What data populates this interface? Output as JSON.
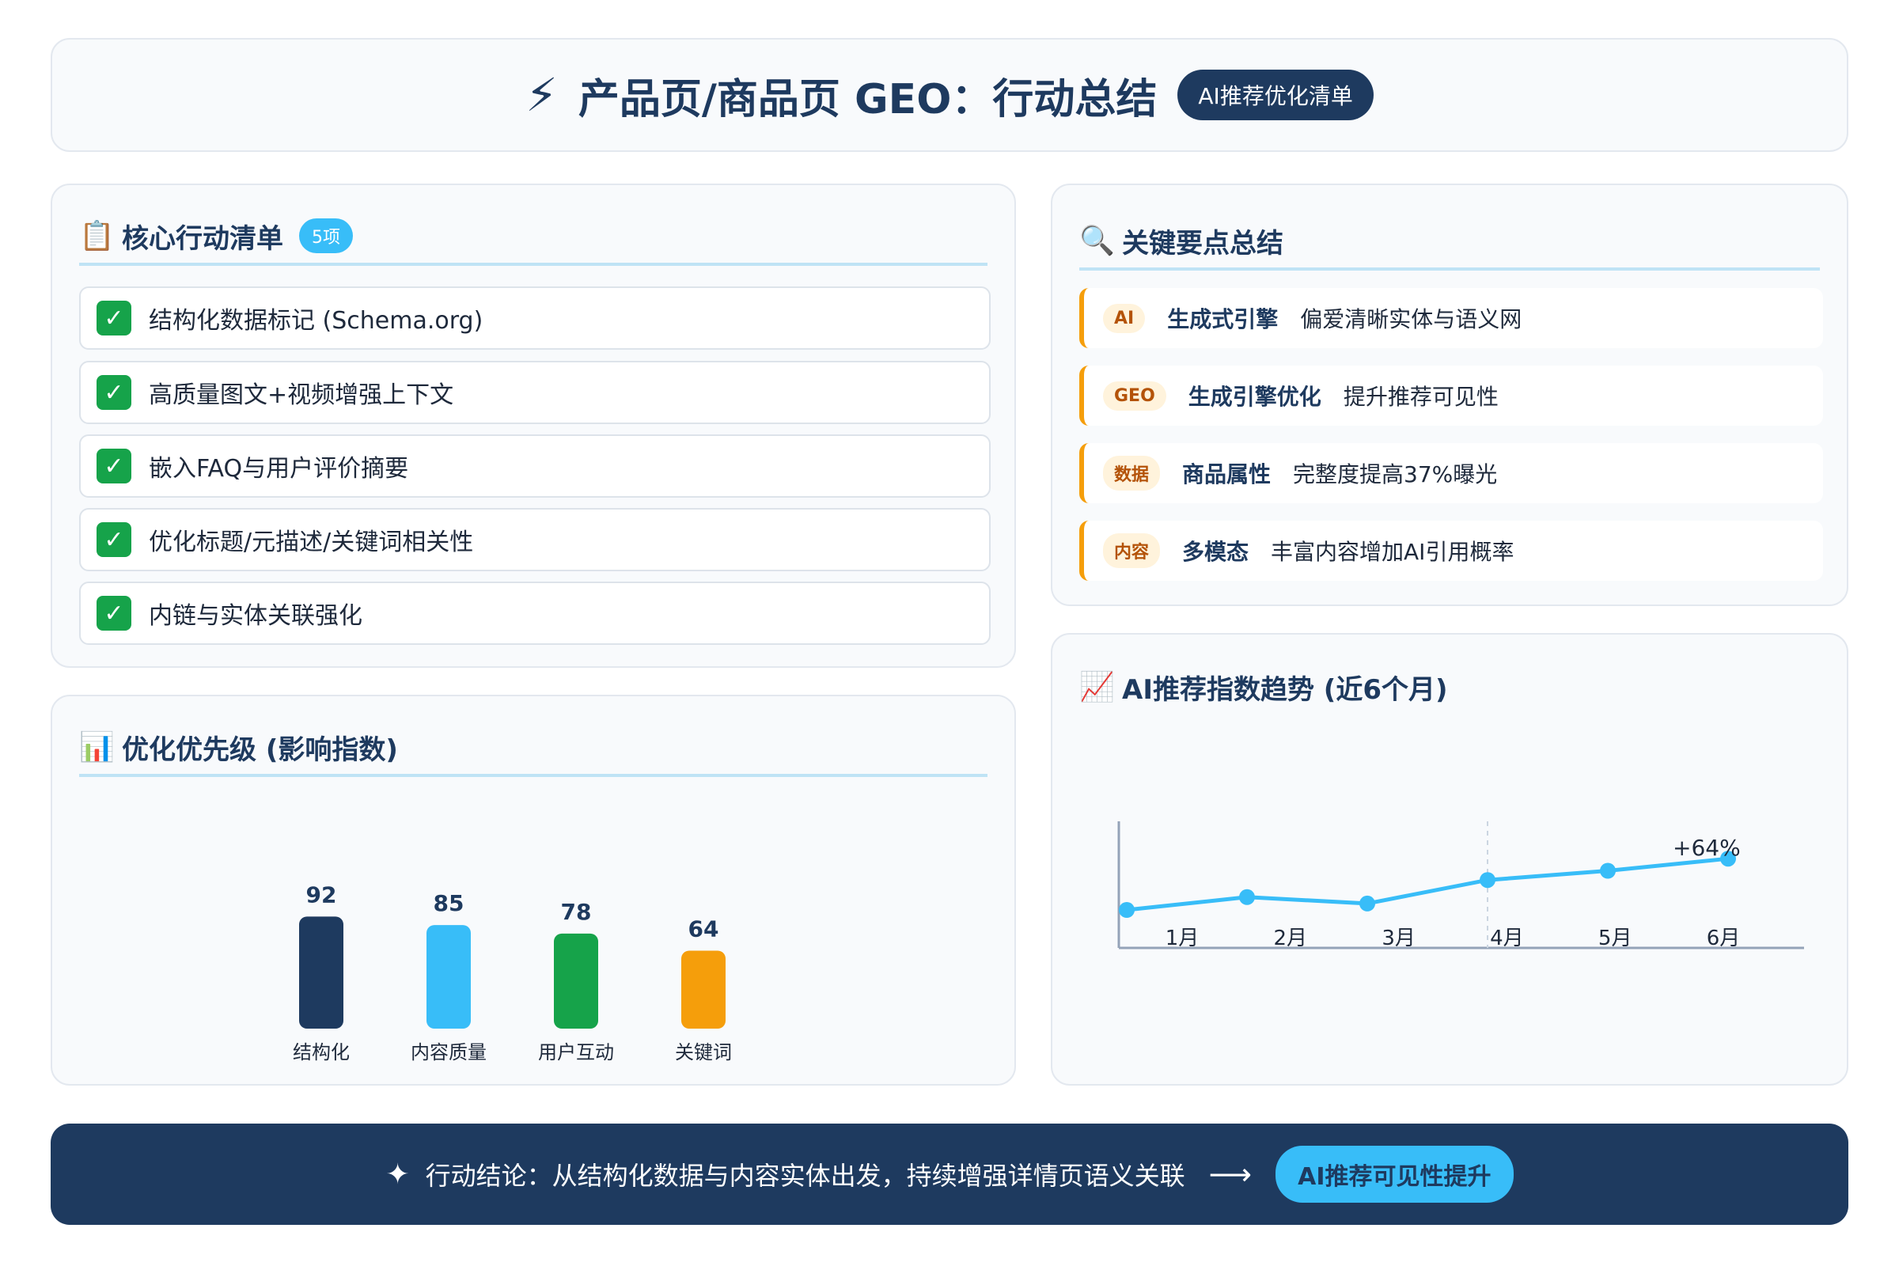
{
  "header": {
    "icon": "lightning-icon",
    "title": "产品页/商品页 GEO：行动总结",
    "tag": "AI推荐优化清单"
  },
  "actions": {
    "icon": "clipboard-icon",
    "title": "核心行动清单",
    "count_badge": "5项",
    "items": [
      {
        "label": "结构化数据标记 (Schema.org)"
      },
      {
        "label": "高质量图文+视频增强上下文"
      },
      {
        "label": "嵌入FAQ与用户评价摘要"
      },
      {
        "label": "优化标题/元描述/关键词相关性"
      },
      {
        "label": "内链与实体关联强化"
      }
    ]
  },
  "keypoints": {
    "icon": "magnifier-icon",
    "title": "关键要点总结",
    "items": [
      {
        "badge": "AI",
        "key": "生成式引擎",
        "desc": "偏爱清晰实体与语义网"
      },
      {
        "badge": "GEO",
        "key": "生成引擎优化",
        "desc": "提升推荐可见性"
      },
      {
        "badge": "数据",
        "key": "商品属性",
        "desc": "完整度提高37%曝光"
      },
      {
        "badge": "内容",
        "key": "多模态",
        "desc": "丰富内容增加AI引用概率"
      }
    ]
  },
  "priority": {
    "icon": "bar-chart-icon",
    "title": "优化优先级 (影响指数)",
    "chart_data": {
      "type": "bar",
      "categories": [
        "结构化",
        "内容质量",
        "用户互动",
        "关键词"
      ],
      "values": [
        92,
        85,
        78,
        64
      ],
      "colors": [
        "#1e3a5f",
        "#38bdf8",
        "#16a34a",
        "#f59e0b"
      ]
    }
  },
  "trend": {
    "icon": "trend-chart-icon",
    "title": "AI推荐指数趋势 (近6个月)",
    "chart_data": {
      "type": "line",
      "categories": [
        "1月",
        "2月",
        "3月",
        "4月",
        "5月",
        "6月"
      ],
      "values": [
        20,
        38,
        29,
        62,
        75,
        92
      ],
      "annotation": "+64%",
      "color": "#38bdf8"
    }
  },
  "footer": {
    "icon": "sparkle-icon",
    "conclusion": "行动结论：从结构化数据与内容实体出发，持续增强详情页语义关联",
    "arrow": "⟶",
    "cta": "AI推荐可见性提升"
  }
}
